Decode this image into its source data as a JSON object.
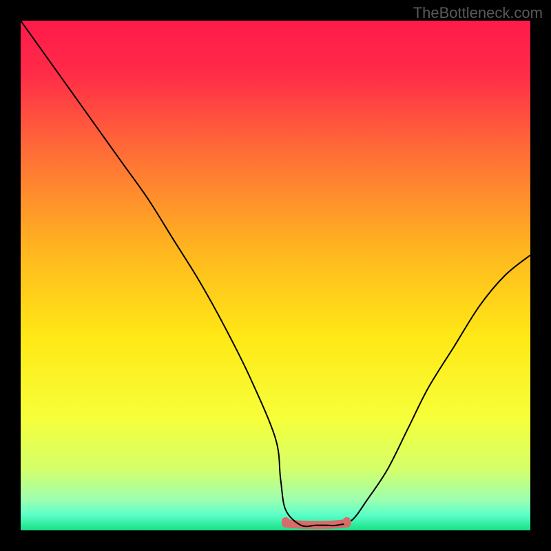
{
  "watermark": "TheBottleneck.com",
  "chart_data": {
    "type": "line",
    "title": "",
    "xlabel": "",
    "ylabel": "",
    "xlim": [
      0,
      100
    ],
    "ylim": [
      0,
      100
    ],
    "gradient_stops": [
      {
        "pos": 0.0,
        "color": "#ff1a4a"
      },
      {
        "pos": 0.1,
        "color": "#ff2a48"
      },
      {
        "pos": 0.25,
        "color": "#ff6a38"
      },
      {
        "pos": 0.45,
        "color": "#ffb61f"
      },
      {
        "pos": 0.62,
        "color": "#ffe815"
      },
      {
        "pos": 0.78,
        "color": "#f6ff3a"
      },
      {
        "pos": 0.88,
        "color": "#d4ff6a"
      },
      {
        "pos": 0.94,
        "color": "#9cffb0"
      },
      {
        "pos": 0.97,
        "color": "#5affc8"
      },
      {
        "pos": 1.0,
        "color": "#18e084"
      }
    ],
    "series": [
      {
        "name": "bottleneck-curve",
        "x": [
          0,
          5,
          10,
          15,
          20,
          25,
          30,
          35,
          40,
          45,
          50,
          51,
          52,
          55,
          58,
          60,
          62,
          65,
          68,
          72,
          76,
          80,
          85,
          90,
          95,
          100
        ],
        "y": [
          100,
          93,
          86,
          79,
          72,
          65,
          57,
          49,
          40,
          30,
          18,
          10,
          4,
          1,
          1,
          1,
          1,
          2,
          6,
          12,
          20,
          28,
          36,
          44,
          50,
          54
        ]
      }
    ],
    "flat_region": {
      "x_start": 52,
      "x_end": 64,
      "y": 1.5,
      "color": "#d96b6b"
    }
  }
}
